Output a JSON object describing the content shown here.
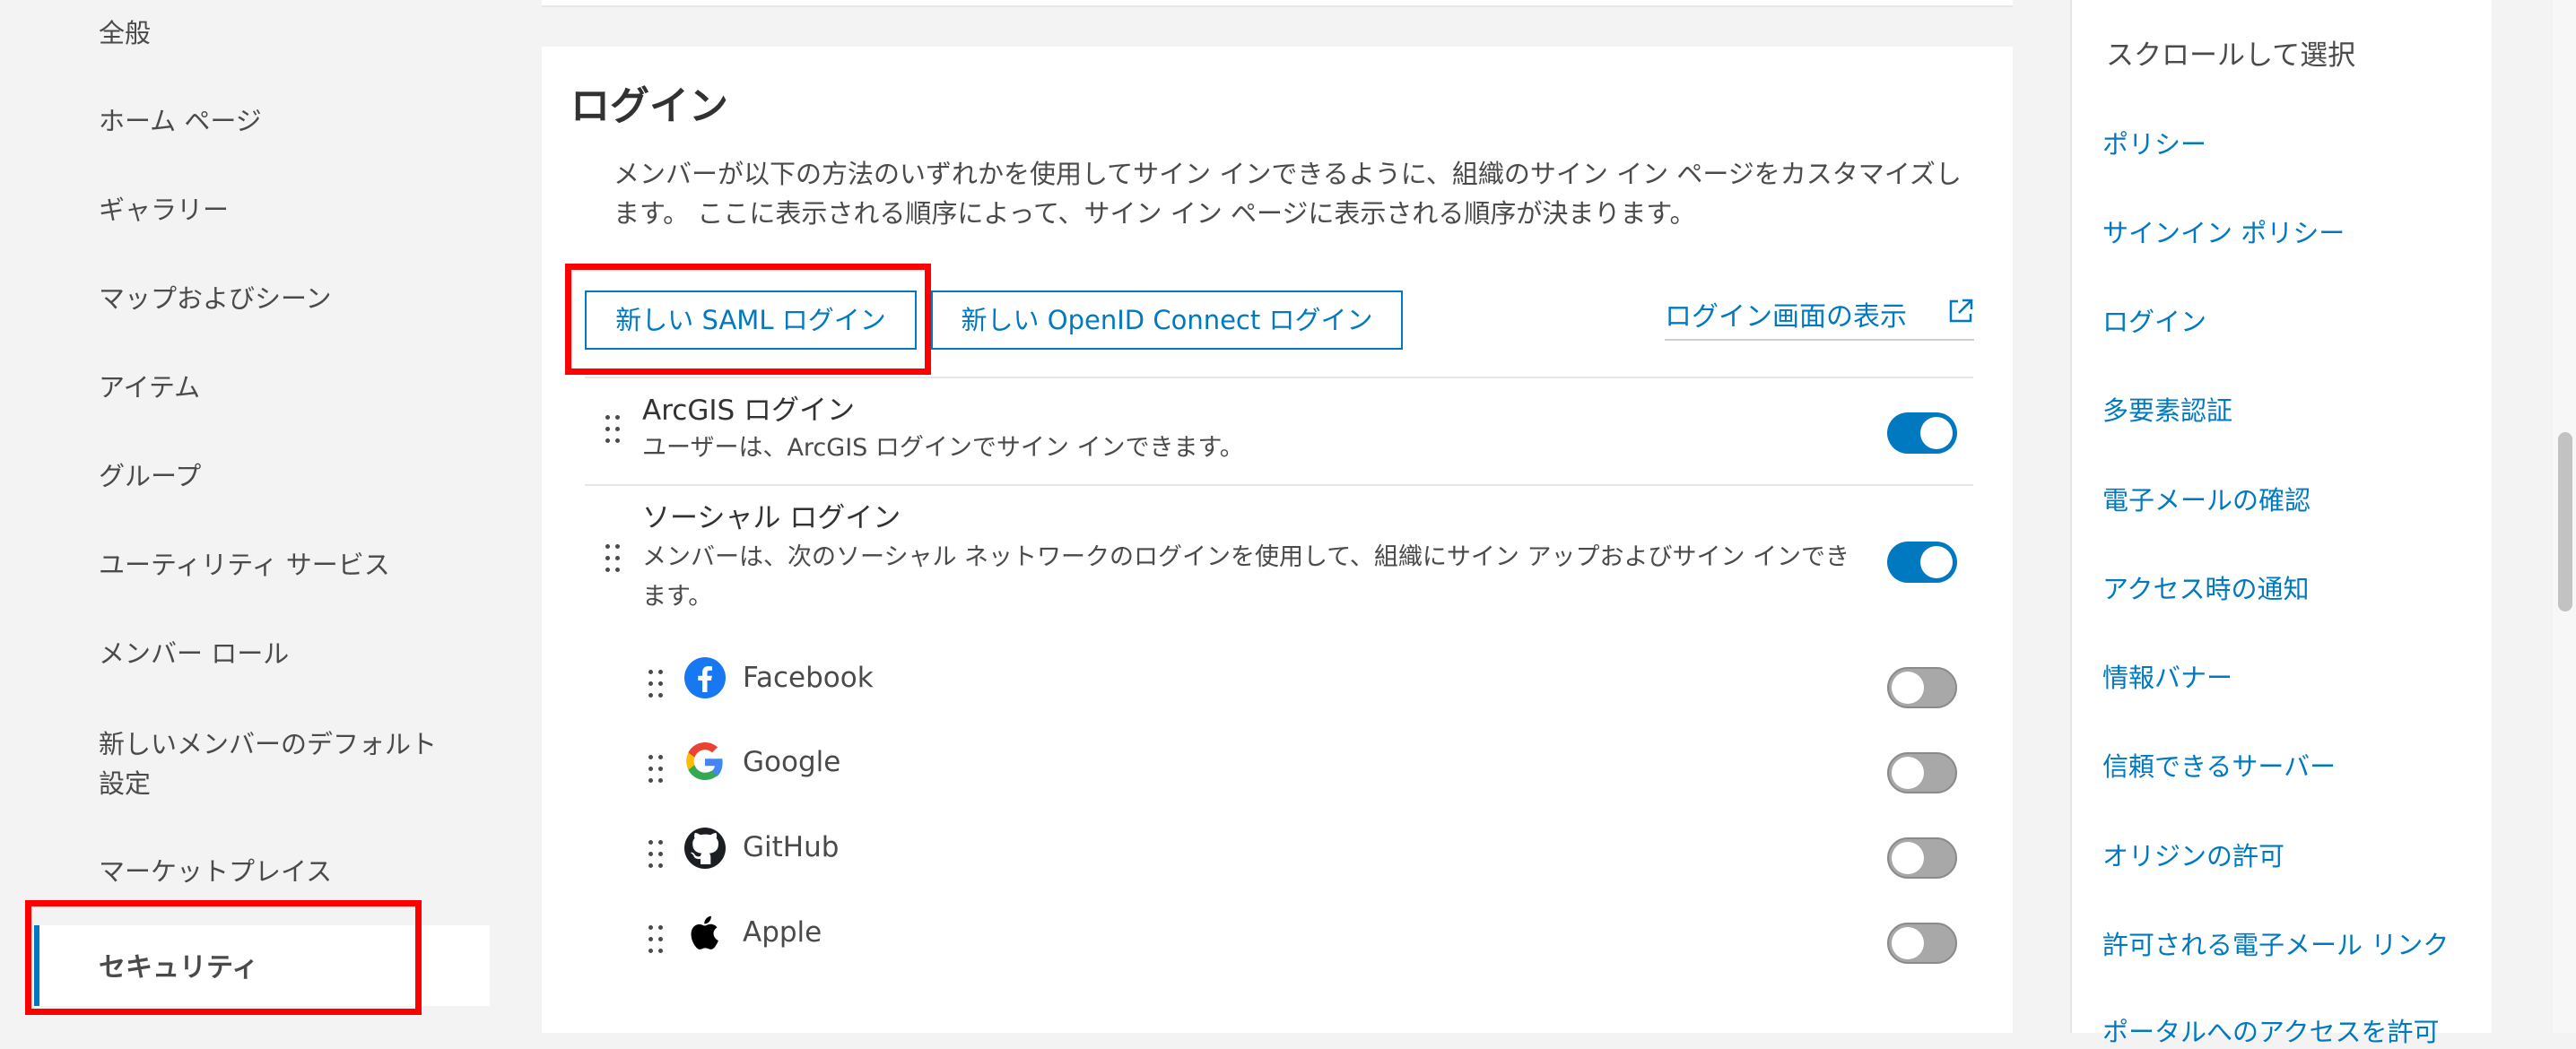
{
  "left_nav": {
    "items": [
      "全般",
      "ホーム ページ",
      "ギャラリー",
      "マップおよびシーン",
      "アイテム",
      "グループ",
      "ユーティリティ サービス",
      "メンバー ロール",
      "新しいメンバーのデフォルト",
      "設定",
      "マーケットプレイス"
    ],
    "active": "セキュリティ"
  },
  "login": {
    "title": "ログイン",
    "description": "メンバーが以下の方法のいずれかを使用してサイン インできるように、組織のサイン イン ページをカスタマイズします。 ここに表示される順序によって、サイン イン ページに表示される順序が決まります。",
    "new_saml_button": "新しい SAML ログイン",
    "new_openid_button": "新しい OpenID Connect ログイン",
    "view_login_link": "ログイン画面の表示",
    "arcgis": {
      "title": "ArcGIS ログイン",
      "subtitle": "ユーザーは、ArcGIS ログインでサイン インできます。",
      "enabled": true
    },
    "social": {
      "title": "ソーシャル ログイン",
      "subtitle": "メンバーは、次のソーシャル ネットワークのログインを使用して、組織にサイン アップおよびサイン インできます。",
      "enabled": true,
      "providers": [
        {
          "name": "Facebook",
          "icon": "facebook-icon",
          "enabled": false,
          "color": "#1877f2"
        },
        {
          "name": "Google",
          "icon": "google-icon",
          "enabled": false
        },
        {
          "name": "GitHub",
          "icon": "github-icon",
          "enabled": false
        },
        {
          "name": "Apple",
          "icon": "apple-icon",
          "enabled": false
        }
      ]
    }
  },
  "right_panel": {
    "title": "スクロールして選択",
    "links": [
      "ポリシー",
      "サインイン ポリシー",
      "ログイン",
      "多要素認証",
      "電子メールの確認",
      "アクセス時の通知",
      "情報バナー",
      "信頼できるサーバー",
      "オリジンの許可",
      "許可される電子メール リンク",
      "ポータルへのアクセスを許可"
    ]
  },
  "colors": {
    "accent": "#0079c1",
    "highlight": "#ff0000"
  }
}
